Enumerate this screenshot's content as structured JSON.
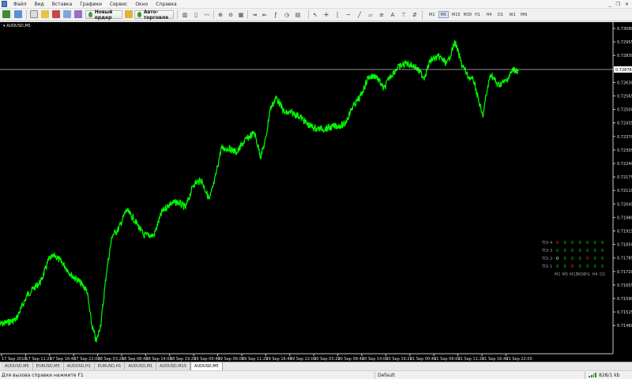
{
  "menu": {
    "items": [
      "Файл",
      "Вид",
      "Вставка",
      "Графики",
      "Сервис",
      "Окно",
      "Справка"
    ],
    "window_controls": [
      "_",
      "❐",
      "✕"
    ]
  },
  "toolbar": {
    "new_order_label": "Новый ордер",
    "auto_trading_label": "Авто-торговля",
    "timeframes": [
      "M1",
      "M5",
      "M15",
      "M30",
      "H1",
      "H4",
      "D1",
      "W1",
      "MN"
    ],
    "active_timeframe": "M5"
  },
  "chart": {
    "title": "AUDUSD,M5",
    "current_price": "0.72876",
    "colors": {
      "background": "#000000",
      "price_line": "#00ff00",
      "current_line": "#c0c0c0",
      "label_bg": "#ffffff"
    },
    "price_labels": [
      "0.73080",
      "0.72955",
      "0.72830",
      "0.72765",
      "0.72630",
      "0.72565",
      "0.72500",
      "0.72435",
      "0.72370",
      "0.72305",
      "0.72240",
      "0.72175",
      "0.72110",
      "0.72045",
      "0.71980",
      "0.71915",
      "0.71850",
      "0.71785",
      "0.71720",
      "0.71655",
      "0.71590",
      "0.71525",
      "0.71460"
    ],
    "time_labels": [
      "17 Sep 2018",
      "17 Sep 11:20",
      "17 Sep 16:40",
      "17 Sep 22:00",
      "18 Sep 03:20",
      "18 Sep 08:40",
      "18 Sep 14:00",
      "18 Sep 19:20",
      "19 Sep 00:40",
      "19 Sep 06:00",
      "19 Sep 11:20",
      "19 Sep 16:40",
      "19 Sep 22:00",
      "20 Sep 03:20",
      "20 Sep 08:40",
      "20 Sep 14:00",
      "20 Sep 19:20",
      "21 Sep 00:40",
      "21 Sep 06:00",
      "21 Sep 11:20",
      "21 Sep 16:40",
      "21 Sep 22:00"
    ],
    "tdi": {
      "rows": [
        {
          "label": "TDI 4",
          "values": [
            "0",
            "0",
            "0",
            "0",
            "0",
            "0",
            "0"
          ]
        },
        {
          "label": "TDI 3",
          "values": [
            "0",
            "0",
            "0",
            "0",
            "0",
            "0",
            "0"
          ]
        },
        {
          "label": "TDI 2",
          "values": [
            "0",
            "0",
            "0",
            "0",
            "0",
            "0",
            "0"
          ]
        },
        {
          "label": "TDI 1",
          "values": [
            "0",
            "0",
            "0",
            "0",
            "0",
            "0",
            "0"
          ]
        }
      ],
      "columns": [
        "M1",
        "M5",
        "M15",
        "M30",
        "H1",
        "H4",
        "D1"
      ],
      "value_colors": [
        [
          "#ff3030",
          "#00dd00",
          "#00dd00",
          "#00dd00",
          "#00dd00",
          "#00dd00",
          "#00dd00"
        ],
        [
          "#00dd00",
          "#00dd00",
          "#00dd00",
          "#00dd00",
          "#00dd00",
          "#00dd00",
          "#00dd00"
        ],
        [
          "#ffffff",
          "#00dd00",
          "#00dd00",
          "#00dd00",
          "#ff3030",
          "#00dd00",
          "#00dd00"
        ],
        [
          "#00dd00",
          "#00dd00",
          "#ff3030",
          "#00dd00",
          "#00dd00",
          "#00dd00",
          "#00dd00"
        ]
      ]
    }
  },
  "tabs": {
    "items": [
      "AUDUSD,M5",
      "EURUSD,M5",
      "AUDUSD,H1",
      "EURUSD,H1",
      "AUDUSD,M1",
      "AUDUSD,M15",
      "AUDUSD,M5"
    ],
    "active_index": 6
  },
  "status": {
    "help_text": "Для вызова справки нажмите F1",
    "profile": "Default",
    "traffic": "828/1 kb"
  }
}
